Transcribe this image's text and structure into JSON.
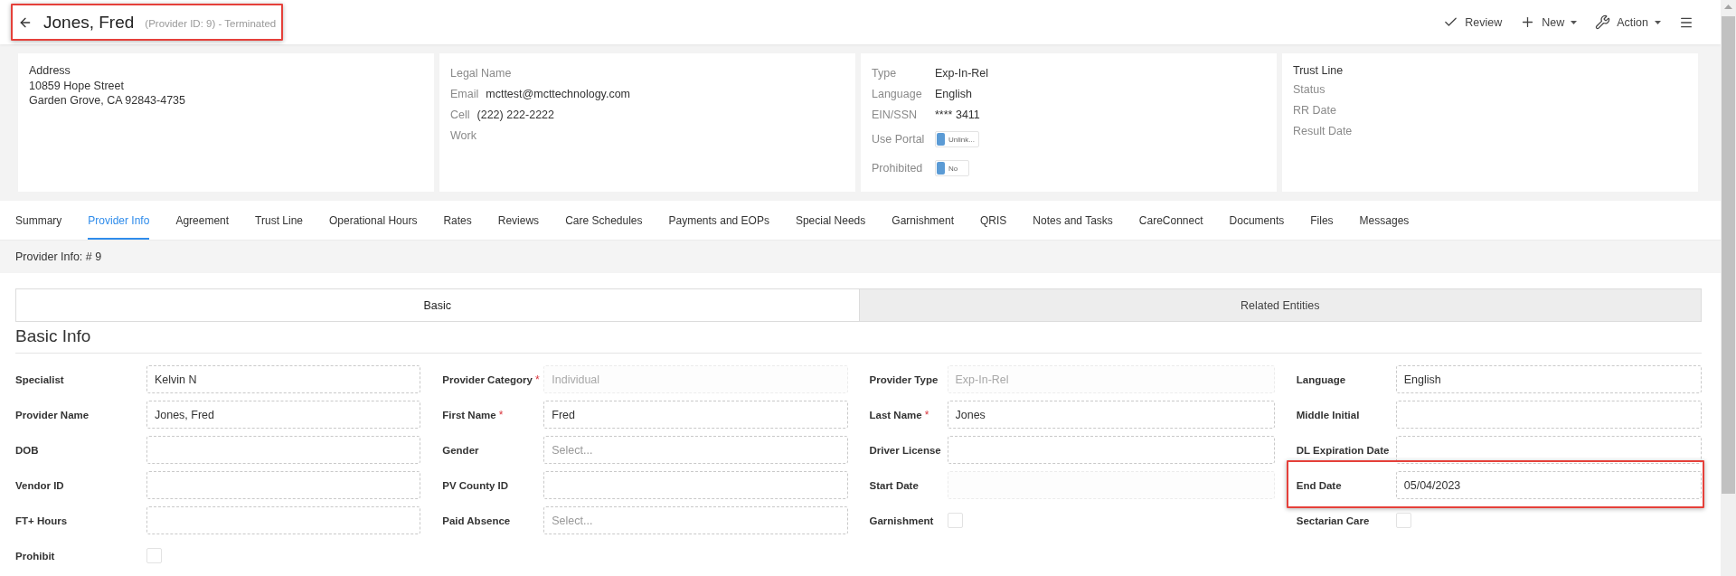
{
  "header": {
    "title": "Jones, Fred",
    "subtitle": "(Provider ID: 9) - Terminated",
    "highlighted": true
  },
  "actions": [
    {
      "label": "Review",
      "dropdown": false
    },
    {
      "label": "New",
      "dropdown": true
    },
    {
      "label": "Action",
      "dropdown": true
    }
  ],
  "summary_cards": [
    {
      "title": "Address",
      "lines": [
        "10859 Hope Street",
        "Garden Grove, CA 92843-4735"
      ]
    },
    {
      "items": [
        {
          "kind": "field",
          "label": "Legal Name"
        },
        {
          "kind": "field",
          "label": "Email",
          "value": "mcttest@mcttechnology.com"
        },
        {
          "kind": "field",
          "label": "Cell",
          "value": "(222) 222-2222"
        },
        {
          "kind": "field",
          "label": "Work"
        }
      ]
    },
    {
      "items": [
        {
          "kind": "field",
          "label": "Type",
          "value": "Exp-In-Rel"
        },
        {
          "kind": "field",
          "label": "Language",
          "value": "English"
        },
        {
          "kind": "field",
          "label": "EIN/SSN",
          "value": "**** 3411"
        },
        {
          "kind": "toggle",
          "label": "Use Portal",
          "text": "Unlink...",
          "on": false
        },
        {
          "kind": "toggle",
          "label": "Prohibited",
          "text": "No",
          "on": false
        }
      ]
    },
    {
      "title": "Trust Line",
      "items": [
        {
          "kind": "field",
          "label": "Status"
        },
        {
          "kind": "field",
          "label": "RR Date"
        },
        {
          "kind": "field",
          "label": "Result Date"
        }
      ]
    }
  ],
  "tabs": [
    {
      "label": "Summary",
      "selected": false
    },
    {
      "label": "Provider Info",
      "selected": true
    },
    {
      "label": "Agreement",
      "selected": false
    },
    {
      "label": "Trust Line",
      "selected": false
    },
    {
      "label": "Operational Hours",
      "selected": false
    },
    {
      "label": "Rates",
      "selected": false
    },
    {
      "label": "Reviews",
      "selected": false
    },
    {
      "label": "Care Schedules",
      "selected": false
    },
    {
      "label": "Payments and EOPs",
      "selected": false
    },
    {
      "label": "Special Needs",
      "selected": false
    },
    {
      "label": "Garnishment",
      "selected": false
    },
    {
      "label": "QRIS",
      "selected": false
    },
    {
      "label": "Notes and Tasks",
      "selected": false
    },
    {
      "label": "CareConnect",
      "selected": false
    },
    {
      "label": "Documents",
      "selected": false
    },
    {
      "label": "Files",
      "selected": false
    },
    {
      "label": "Messages",
      "selected": false
    }
  ],
  "info_bar": "Provider Info: # 9",
  "subtabs": [
    {
      "label": "Basic",
      "selected": true
    },
    {
      "label": "Related Entities",
      "selected": false
    }
  ],
  "section_title": "Basic Info",
  "form_columns": [
    [
      {
        "kind": "input",
        "label": "Specialist",
        "value": "Kelvin N",
        "disabled": false,
        "highlighted": false
      },
      {
        "kind": "input",
        "label": "Provider Name",
        "value": "Jones, Fred",
        "disabled": false,
        "highlighted": false
      },
      {
        "kind": "input",
        "label": "DOB",
        "disabled": false,
        "highlighted": false
      },
      {
        "kind": "input",
        "label": "Vendor ID",
        "disabled": false,
        "highlighted": false
      },
      {
        "kind": "input",
        "label": "FT+ Hours",
        "disabled": false,
        "highlighted": false
      },
      {
        "kind": "checkbox",
        "label": "Prohibit",
        "checked": false,
        "highlighted": false
      }
    ],
    [
      {
        "kind": "input",
        "label": "Provider Category",
        "required_mark": "*",
        "value": "Individual",
        "disabled": true,
        "highlighted": false
      },
      {
        "kind": "input",
        "label": "First Name",
        "required_mark": "*",
        "value": "Fred",
        "disabled": false,
        "highlighted": false
      },
      {
        "kind": "input",
        "label": "Gender",
        "placeholder": "Select...",
        "disabled": false,
        "highlighted": false
      },
      {
        "kind": "input",
        "label": "PV County ID",
        "disabled": false,
        "highlighted": false
      },
      {
        "kind": "input",
        "label": "Paid Absence",
        "placeholder": "Select...",
        "disabled": false,
        "highlighted": false
      }
    ],
    [
      {
        "kind": "input",
        "label": "Provider Type",
        "value": "Exp-In-Rel",
        "disabled": true,
        "highlighted": false
      },
      {
        "kind": "input",
        "label": "Last Name",
        "required_mark": "*",
        "value": "Jones",
        "disabled": false,
        "highlighted": false
      },
      {
        "kind": "input",
        "label": "Driver License",
        "disabled": false,
        "highlighted": false
      },
      {
        "kind": "input",
        "label": "Start Date",
        "disabled": true,
        "highlighted": false
      },
      {
        "kind": "checkbox",
        "label": "Garnishment",
        "checked": false,
        "highlighted": false
      }
    ],
    [
      {
        "kind": "input",
        "label": "Language",
        "value": "English",
        "disabled": false,
        "highlighted": false
      },
      {
        "kind": "input",
        "label": "Middle Initial",
        "disabled": false,
        "highlighted": false
      },
      {
        "kind": "input",
        "label": "DL Expiration Date",
        "disabled": false,
        "highlighted": false
      },
      {
        "kind": "input",
        "label": "End Date",
        "value": "05/04/2023",
        "disabled": false,
        "highlighted": true
      },
      {
        "kind": "checkbox",
        "label": "Sectarian Care",
        "checked": false,
        "highlighted": false
      }
    ]
  ]
}
